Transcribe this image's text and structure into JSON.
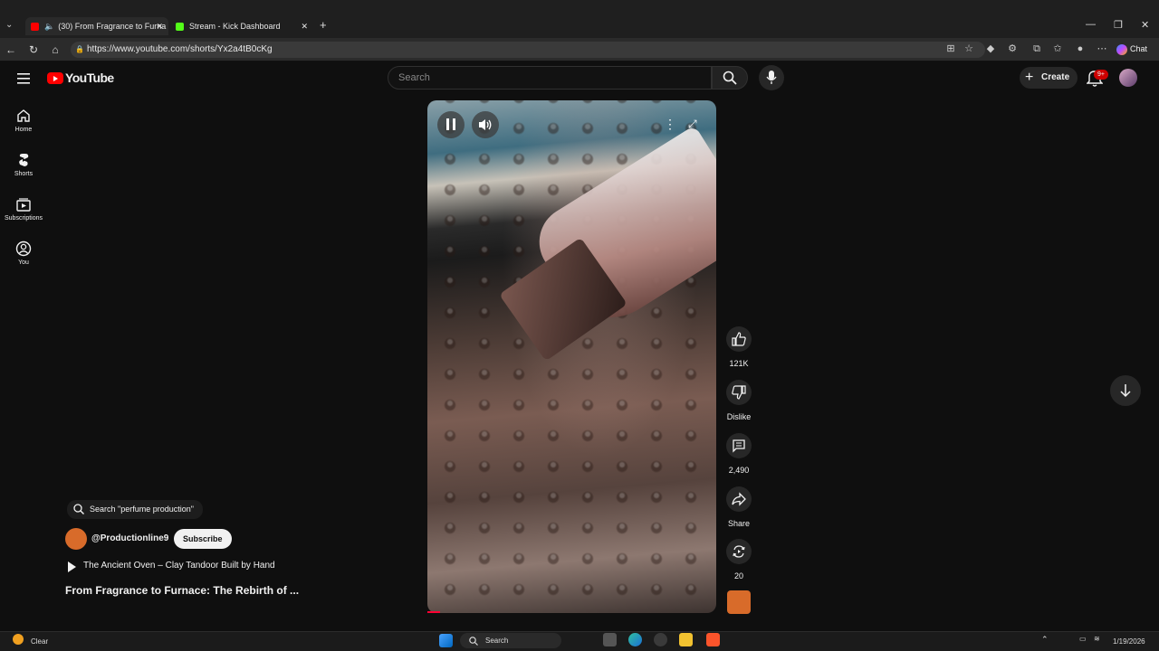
{
  "browser": {
    "tabs": [
      {
        "label": "(30) From Fragrance to Furna",
        "favicon_color": "#ff0000"
      },
      {
        "label": "Stream - Kick Dashboard",
        "favicon_color": "#53fc18"
      }
    ],
    "url": "https://www.youtube.com/shorts/Yx2a4tB0cKg",
    "chat_label": "Chat"
  },
  "header": {
    "logo_text": "YouTube",
    "search_placeholder": "Search",
    "create_label": "Create",
    "notification_count": "9+"
  },
  "sidebar": {
    "items": [
      {
        "label": "Home",
        "icon": "home-icon"
      },
      {
        "label": "Shorts",
        "icon": "shorts-icon"
      },
      {
        "label": "Subscriptions",
        "icon": "subscriptions-icon"
      },
      {
        "label": "You",
        "icon": "you-icon"
      }
    ]
  },
  "actions": {
    "likes": "121K",
    "dislike_label": "Dislike",
    "comments": "2,490",
    "share_label": "Share",
    "remix_count": "20"
  },
  "info": {
    "search_chip": "Search \"perfume production\"",
    "channel": "@Productionline9",
    "subscribe_label": "Subscribe",
    "related_video": "The Ancient Oven – Clay Tandoor Built by Hand",
    "title": "From Fragrance to Furnace: The Rebirth of ..."
  },
  "taskbar": {
    "weather": "Clear",
    "search_label": "Search",
    "date": "1/19/2026"
  },
  "colors": {
    "accent_red": "#ff0000",
    "background": "#0f0f0f"
  }
}
